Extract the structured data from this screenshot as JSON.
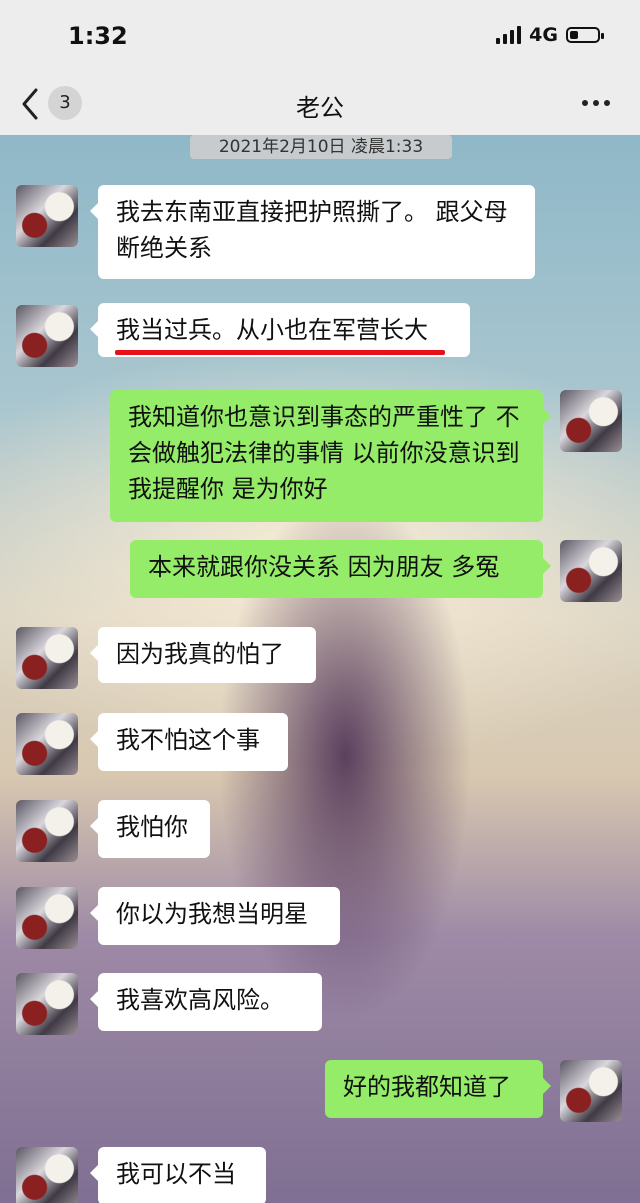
{
  "status_bar": {
    "time": "1:32",
    "network": "4G",
    "battery_level": 0.25
  },
  "nav": {
    "back_icon": "chevron-left-icon",
    "unread_count": "3",
    "title": "老公",
    "more_icon": "more-icon"
  },
  "chat": {
    "timestamp": "2021年2月10日 凌晨1:33",
    "messages": [
      {
        "side": "in",
        "text": "我去东南亚直接把护照撕了。 跟父母断绝关系"
      },
      {
        "side": "in",
        "text": "我当过兵。从小也在军营长大",
        "highlighted": true
      },
      {
        "side": "out",
        "text": "我知道你也意识到事态的严重性了 不会做触犯法律的事情 以前你没意识到 我提醒你 是为你好"
      },
      {
        "side": "out",
        "text": "本来就跟你没关系 因为朋友 多冤"
      },
      {
        "side": "in",
        "text": "因为我真的怕了"
      },
      {
        "side": "in",
        "text": "我不怕这个事"
      },
      {
        "side": "in",
        "text": "我怕你"
      },
      {
        "side": "in",
        "text": "你以为我想当明星"
      },
      {
        "side": "in",
        "text": "我喜欢高风险。"
      },
      {
        "side": "out",
        "text": "好的我都知道了"
      },
      {
        "side": "in",
        "text": "我可以不当"
      }
    ]
  },
  "colors": {
    "outgoing_bubble": "#95ec69",
    "incoming_bubble": "#ffffff",
    "highlight_underline": "#e6101a"
  }
}
